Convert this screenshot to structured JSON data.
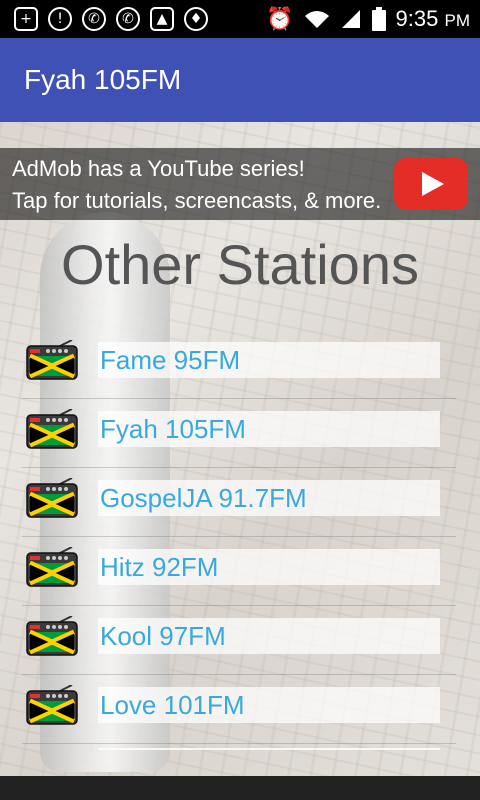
{
  "status_bar": {
    "icons": [
      "plus-icon",
      "download-icon",
      "whatsapp-icon",
      "whatsapp-icon",
      "image-icon",
      "location-icon",
      "alarm-icon",
      "wifi-icon",
      "signal-icon",
      "battery-icon"
    ],
    "time": "9:35",
    "ampm": "PM"
  },
  "app_bar": {
    "title": "Fyah 105FM",
    "color": "#3f51b5"
  },
  "ad": {
    "line1": "AdMob has a YouTube series!",
    "line2": "Tap for tutorials, screencasts, & more."
  },
  "heading": "Other Stations",
  "stations": [
    {
      "name": "Fame 95FM"
    },
    {
      "name": "Fyah 105FM"
    },
    {
      "name": "GospelJA 91.7FM"
    },
    {
      "name": "Hitz 92FM"
    },
    {
      "name": "Kool 97FM"
    },
    {
      "name": "Love 101FM"
    }
  ],
  "colors": {
    "station_text": "#39a9db",
    "heading_text": "#555555"
  }
}
